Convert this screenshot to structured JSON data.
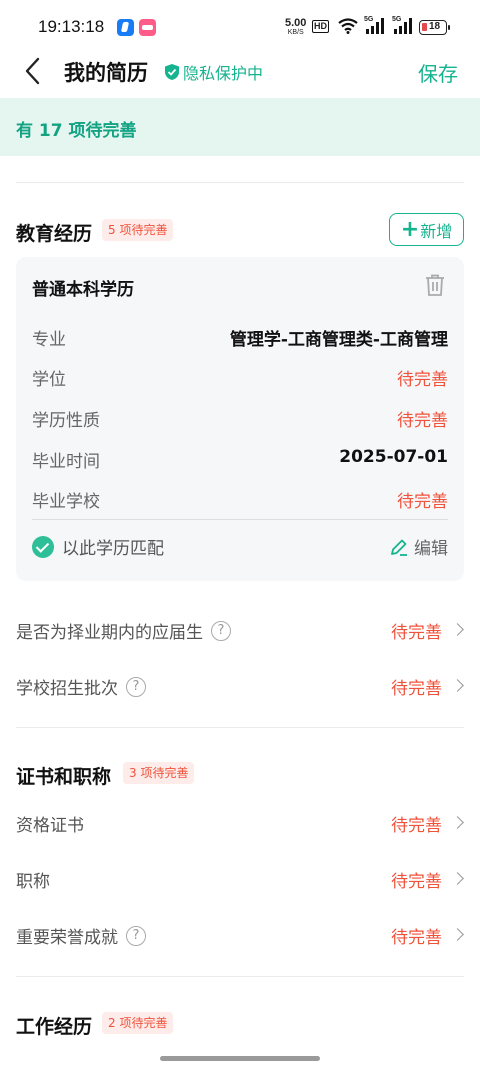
{
  "status": {
    "time": "19:13:18",
    "net_speed": "5.00",
    "net_unit": "KB/S",
    "hd": "HD",
    "sig1": "5G",
    "sig2": "5G",
    "battery": "18"
  },
  "nav": {
    "title": "我的简历",
    "privacy": "隐私保护中",
    "save": "保存"
  },
  "banner": {
    "text": "有 17 项待完善"
  },
  "education": {
    "title": "教育经历",
    "badge": "5 项待完善",
    "add": "新增",
    "card": {
      "title": "普通本科学历",
      "fields": [
        {
          "label": "专业",
          "value": "管理学-工商管理类-工商管理"
        },
        {
          "label": "学位",
          "value": "待完善"
        },
        {
          "label": "学历性质",
          "value": "待完善"
        },
        {
          "label": "毕业时间",
          "value": "2025-07-01"
        },
        {
          "label": "毕业学校",
          "value": "待完善"
        }
      ],
      "match": "以此学历匹配",
      "edit": "编辑"
    },
    "rows": [
      {
        "label": "是否为择业期内的应届生",
        "value": "待完善"
      },
      {
        "label": "学校招生批次",
        "value": "待完善"
      }
    ]
  },
  "certs": {
    "title": "证书和职称",
    "badge": "3 项待完善",
    "rows": [
      {
        "label": "资格证书",
        "value": "待完善"
      },
      {
        "label": "职称",
        "value": "待完善"
      },
      {
        "label": "重要荣誉成就",
        "value": "待完善"
      }
    ]
  },
  "work": {
    "title": "工作经历",
    "badge": "2 项待完善"
  },
  "help_glyph": "?",
  "colors": {
    "accent": "#16b38f",
    "pending": "#f0533c",
    "banner_bg": "#e5f6f1"
  }
}
